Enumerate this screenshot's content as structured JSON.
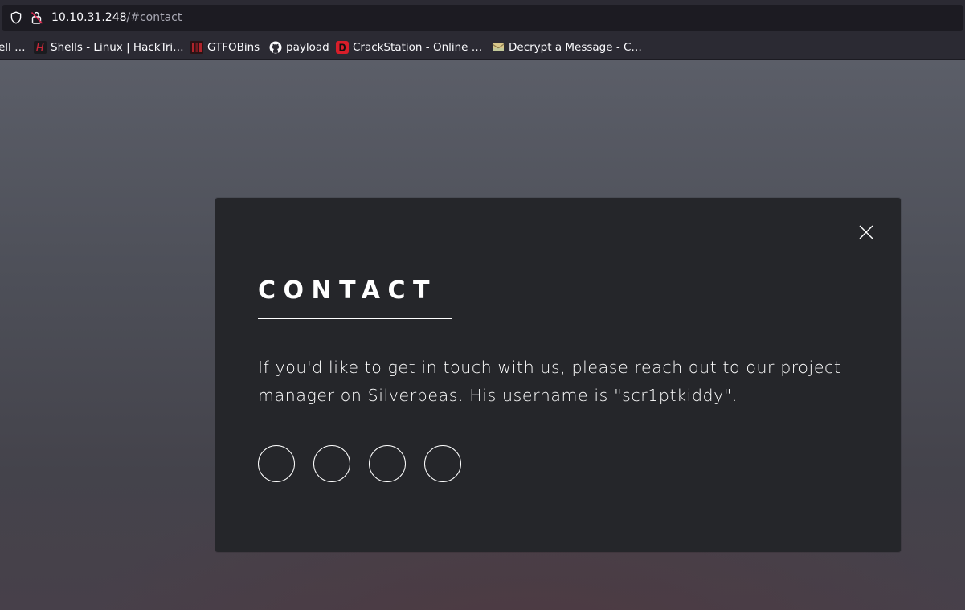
{
  "browser": {
    "url_host": "10.10.31.248",
    "url_path": "/#contact",
    "shield_icon": "shield-icon",
    "lock_icon": "insecure-lock-icon"
  },
  "bookmarks": [
    {
      "label": "ell …",
      "icon": "none"
    },
    {
      "label": "Shells - Linux | HackTri…",
      "icon": "hacktricks-icon",
      "color": "#c8283a"
    },
    {
      "label": "GTFOBins",
      "icon": "gtfobins-icon",
      "color": "#b0242c"
    },
    {
      "label": "payload",
      "icon": "github-icon",
      "color": "#fbfbfe"
    },
    {
      "label": "CrackStation - Online …",
      "icon": "crackstation-icon",
      "color": "#d81e2a"
    },
    {
      "label": "Decrypt a Message - C…",
      "icon": "envelope-icon",
      "color": "#d8c68a"
    }
  ],
  "modal": {
    "title": "CONTACT",
    "message": "If you'd like to get in touch with us, please reach out to our project manager on Silverpeas. His username is \"scr1ptkiddy\".",
    "close_icon": "close-icon",
    "social_count": 4
  },
  "colors": {
    "modal_bg": "#25262a",
    "toolbar_bg": "#2b2a33",
    "url_bg": "#1c1b22",
    "text": "#ffffff"
  }
}
